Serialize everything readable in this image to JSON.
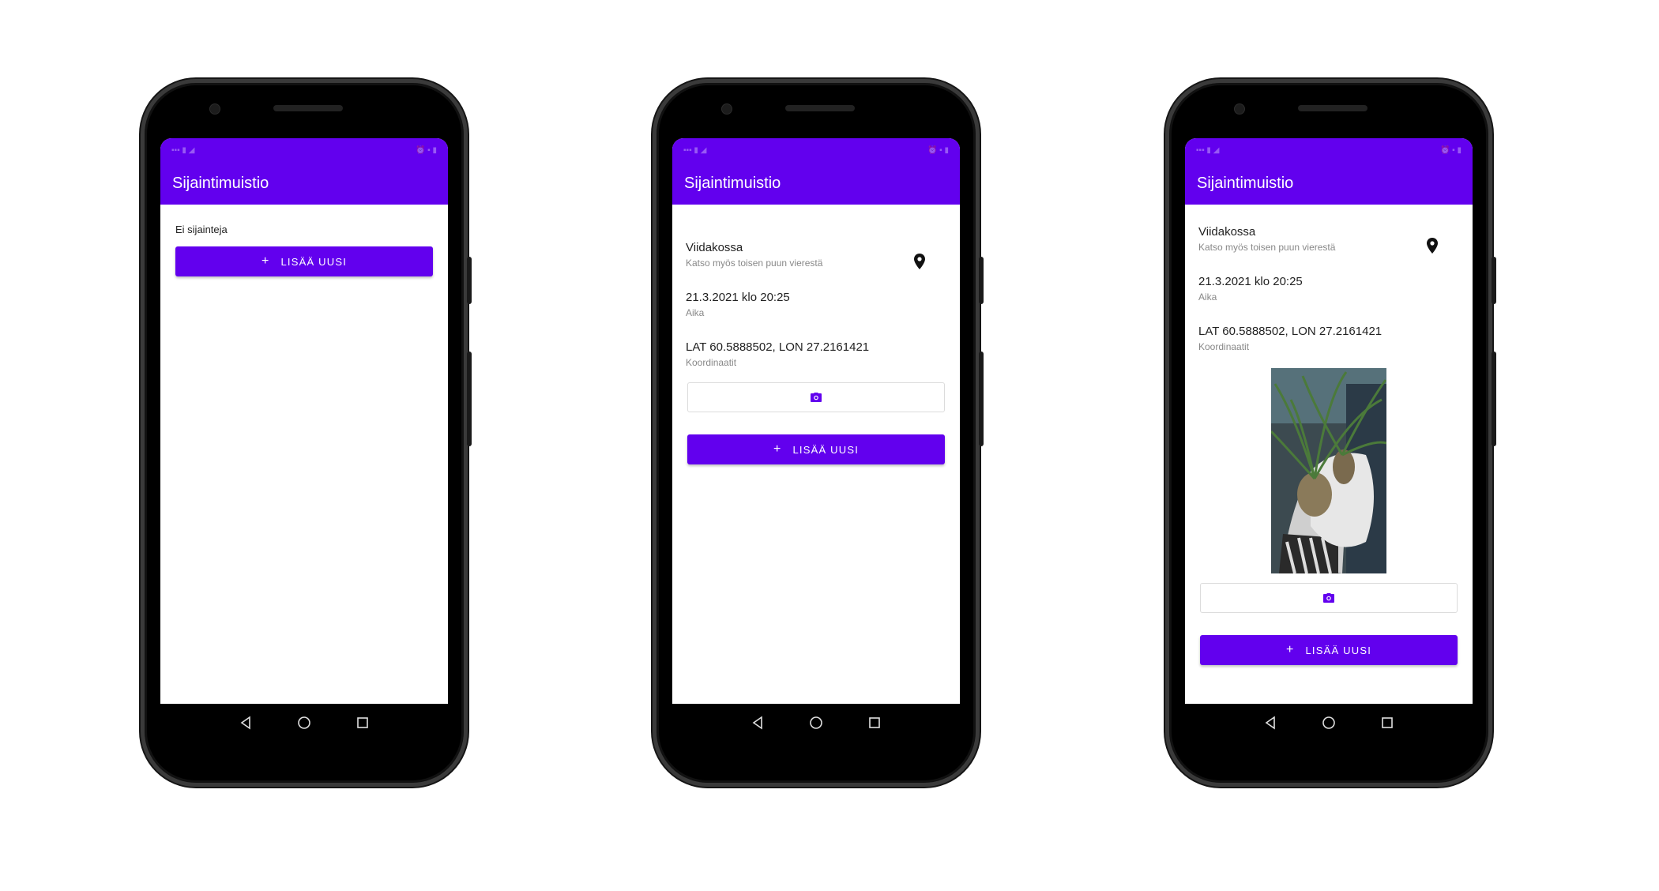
{
  "app": {
    "title": "Sijaintimuistio",
    "accent": "#6200ee"
  },
  "empty_screen": {
    "message": "Ei sijainteja",
    "add_button": "LISÄÄ UUSI"
  },
  "detail_screen": {
    "place_name": "Viidakossa",
    "place_note": "Katso myös toisen puun vierestä",
    "time_value": "21.3.2021 klo 20:25",
    "time_label": "Aika",
    "coords_value": "LAT 60.5888502,  LON 27.2161421",
    "coords_label": "Koordinaatit",
    "add_button": "LISÄÄ UUSI"
  },
  "icons": [
    "map-pin-icon",
    "camera-icon",
    "plus-icon",
    "back-icon",
    "home-icon",
    "recents-icon"
  ]
}
